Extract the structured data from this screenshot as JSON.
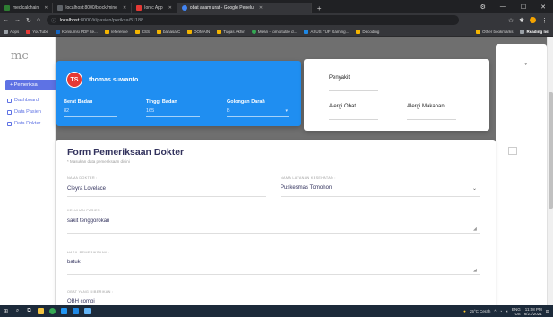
{
  "browser": {
    "tabs": [
      {
        "label": "medicalchain",
        "color": "#2e7d32",
        "active": false
      },
      {
        "label": "localhost:8000/block/mine",
        "color": "#5f6368",
        "active": false
      },
      {
        "label": "Ionic App",
        "color": "#e53935",
        "active": false
      },
      {
        "label": "obat asam urat - Google Penelu",
        "color": "#4285f4",
        "active": true
      }
    ],
    "url_host": "localhost",
    "url_path": ":8000/#/pasien/periksa/51188",
    "bookmarks": [
      {
        "label": "Apps",
        "color": "#9aa0a6"
      },
      {
        "label": "YouTube",
        "color": "#e53935"
      },
      {
        "label": "Konsumsi PDF ke...",
        "color": "#1565c0"
      },
      {
        "label": "reference",
        "color": "#f4b400"
      },
      {
        "label": "CSS",
        "color": "#f4b400"
      },
      {
        "label": "bahasa C",
        "color": "#f4b400"
      },
      {
        "label": "DOMAIN",
        "color": "#f4b400"
      },
      {
        "label": "Tugas Akhir",
        "color": "#f4b400"
      },
      {
        "label": "Mean - tomo tutile d...",
        "color": "#34a853"
      },
      {
        "label": "ASUS TUF Gaming...",
        "color": "#1e88e5"
      },
      {
        "label": "Decoding",
        "color": "#f4b400"
      }
    ],
    "bookmarks_right": [
      {
        "label": "Other bookmarks",
        "color": "#f4b400"
      },
      {
        "label": "Reading list",
        "color": "#9aa0a6"
      }
    ]
  },
  "sidebar": {
    "brand": "mc",
    "items": [
      {
        "label": "+ Pemeriksa"
      },
      {
        "label": "Dashboard"
      },
      {
        "label": "Data Pasien"
      },
      {
        "label": "Data Dokter"
      }
    ]
  },
  "patient": {
    "initials": "TS",
    "name": "thomas suwanto",
    "fields": [
      {
        "label": "Berat Badan",
        "value": "82"
      },
      {
        "label": "Tinggi Badan",
        "value": "165"
      },
      {
        "label": "Golongan Darah",
        "value": "B"
      }
    ]
  },
  "allergy": {
    "disease_label": "Penyakit",
    "drug_label": "Alergi Obat",
    "food_label": "Alergi Makanan"
  },
  "form": {
    "title": "Form Pemeriksaan Dokter",
    "subtitle": "* Masukan data pemeriksaan disini",
    "doctor_label": "NAMA DOKTER :",
    "doctor_value": "Cleyra Lovelace",
    "facility_label": "NAMA LAYANAN KESEHATAN :",
    "facility_value": "Puskesmas Tomohon",
    "complaint_label": "KELUHAN PASIEN :",
    "complaint_value": "sakit tenggorokan",
    "exam_label": "HASIL PEMERIKSAAN :",
    "exam_value": "batuk",
    "drug_label": "OBAT YANG DIBERIKAN :",
    "drug_value": "OBH combi"
  },
  "taskbar": {
    "weather": "25°C Cerah",
    "lang": "ENG",
    "region": "US",
    "time": "11:08 PM",
    "date": "6/21/2021"
  }
}
